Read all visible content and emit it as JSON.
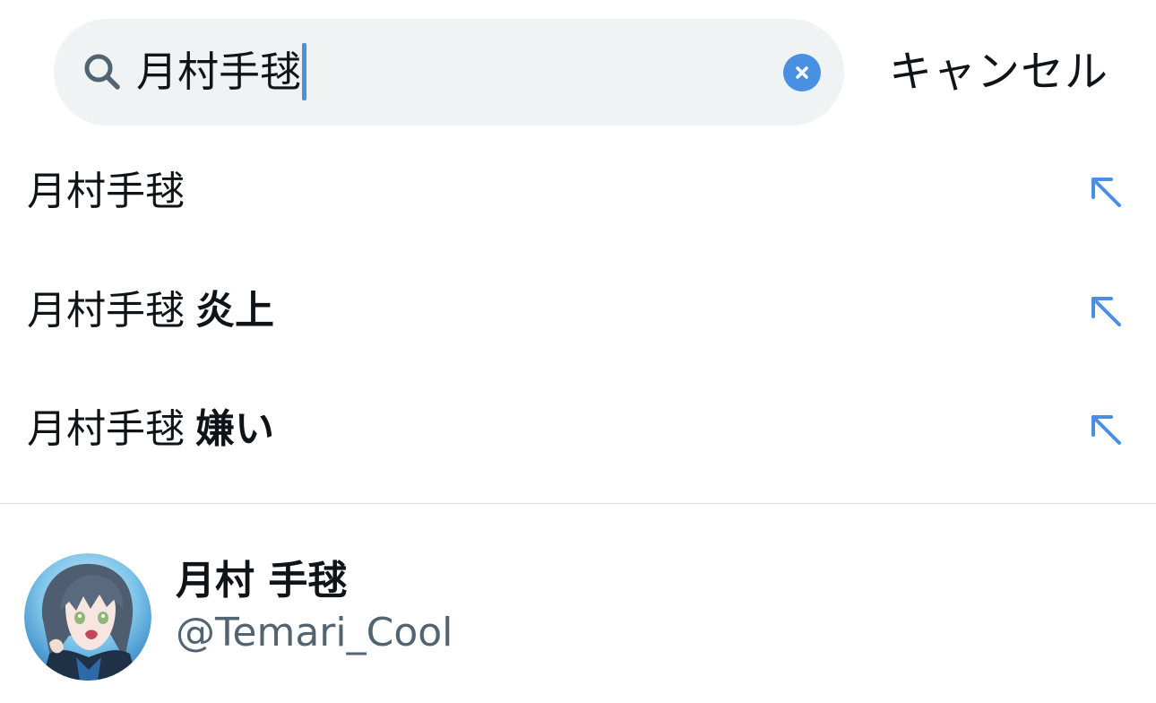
{
  "search": {
    "query": "月村手毬",
    "cancel_label": "キャンセル"
  },
  "suggestions": [
    {
      "base": "月村手毬",
      "extra": ""
    },
    {
      "base": "月村手毬",
      "extra": "炎上"
    },
    {
      "base": "月村手毬",
      "extra": "嫌い"
    }
  ],
  "user_result": {
    "display_name": "月村 手毬",
    "handle": "@Temari_Cool"
  },
  "icons": {
    "search": "search-icon",
    "clear": "clear-icon",
    "fill_suggestion": "arrow-up-left-icon"
  },
  "colors": {
    "accent": "#4a90e2",
    "search_background": "#eff3f4",
    "secondary_text": "#536471",
    "primary_text": "#0f1419"
  }
}
